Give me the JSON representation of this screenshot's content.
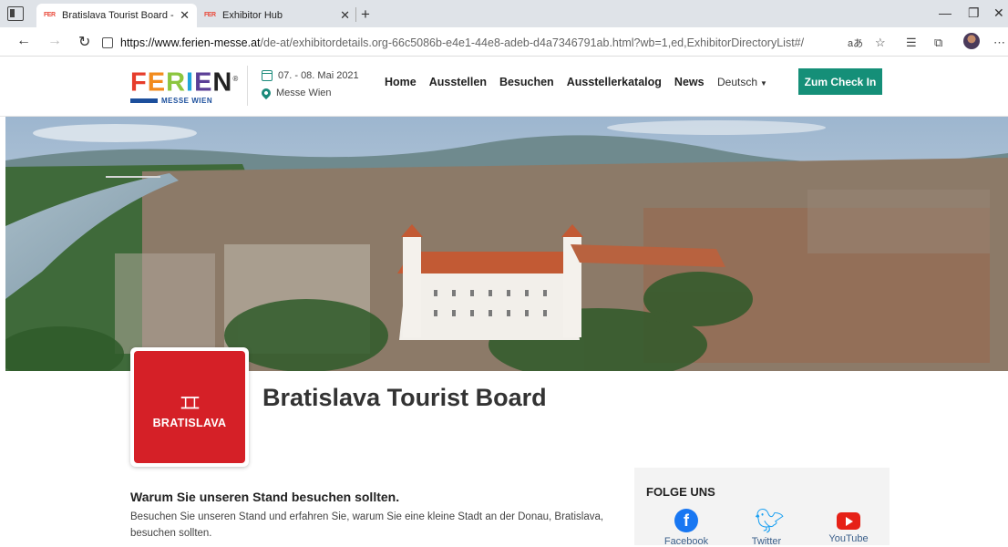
{
  "browser": {
    "tabs": [
      {
        "title": "Bratislava Tourist Board - Ausstel",
        "favicon": "ferien-favicon",
        "active": true
      },
      {
        "title": "Exhibitor Hub",
        "favicon": "ferien-favicon",
        "active": false
      }
    ],
    "tab_close_glyph": "✕",
    "new_tab_glyph": "+",
    "url_host": "https://www.ferien-messe.at",
    "url_path": "/de-at/exhibitordetails.org-66c5086b-e4e1-44e8-adeb-d4a7346791ab.html?wb=1,ed,ExhibitorDirectoryList#/",
    "window_controls": [
      "—",
      "❐",
      "✕"
    ]
  },
  "header": {
    "logo": {
      "word": [
        "F",
        "E",
        "R",
        "I",
        "E",
        "N"
      ],
      "registered": "®",
      "sub": "MESSE WIEN"
    },
    "event_dates": "07. - 08. Mai 2021",
    "event_location": "Messe Wien",
    "nav": [
      "Home",
      "Ausstellen",
      "Besuchen",
      "Ausstellerkatalog",
      "News"
    ],
    "language": "Deutsch",
    "cta": "Zum Check In",
    "colors": {
      "accent": "#158f78",
      "brand_red": "#d52027"
    }
  },
  "hero": {
    "image": "aerial-panorama-bratislava-castle"
  },
  "exhibitor": {
    "logo_mark": "⌶⌶",
    "logo_text": "BRATISLAVA",
    "name": "Bratislava Tourist Board",
    "visit_title": "Warum Sie unseren Stand besuchen sollten.",
    "visit_text": "Besuchen Sie unseren Stand und erfahren Sie, warum Sie eine kleine Stadt an der Donau, Bratislava, besuchen sollten."
  },
  "follow": {
    "title": "FOLGE UNS",
    "links": [
      {
        "label": "Facebook",
        "icon": "facebook-icon"
      },
      {
        "label": "Twitter",
        "icon": "twitter-icon"
      },
      {
        "label": "YouTube",
        "icon": "youtube-icon"
      }
    ]
  }
}
